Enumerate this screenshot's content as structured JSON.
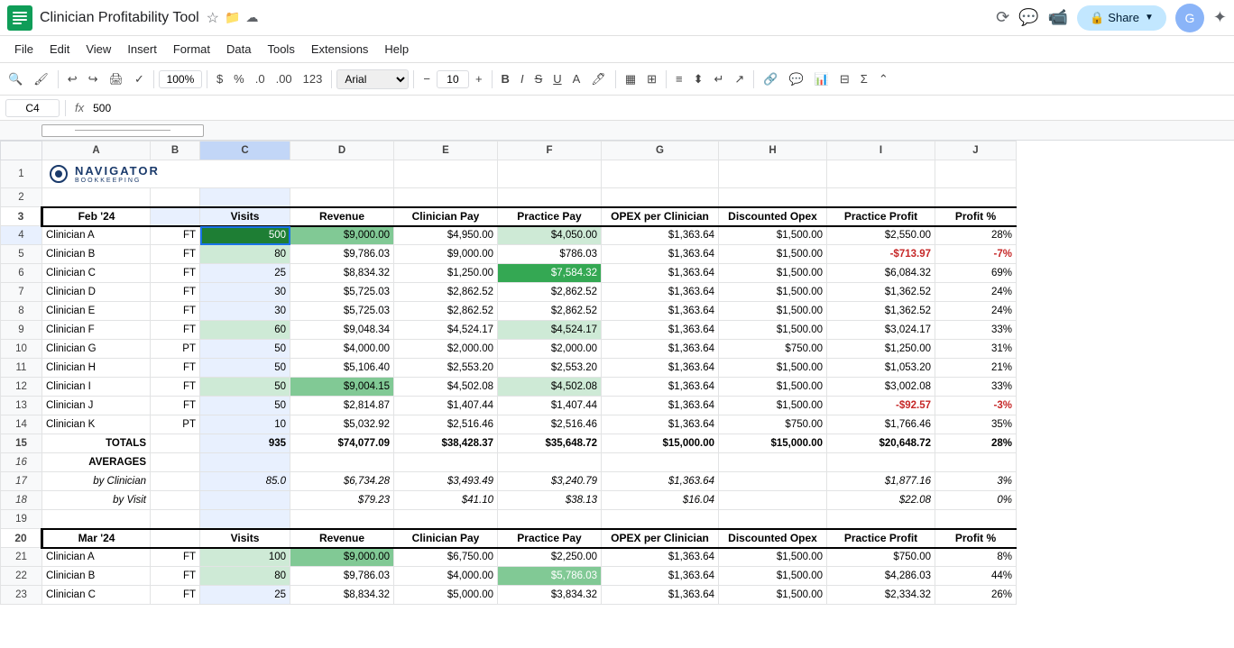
{
  "titleBar": {
    "appName": "Clinician Profitability Tool",
    "starIcon": "★",
    "driveIcon": "📁",
    "cloudIcon": "☁",
    "historyIcon": "⟲",
    "chatIcon": "💬",
    "videoIcon": "📹",
    "shareLabel": "Share",
    "accentColor": "#c2e7ff"
  },
  "menuBar": {
    "items": [
      "File",
      "Edit",
      "View",
      "Insert",
      "Format",
      "Data",
      "Tools",
      "Extensions",
      "Help"
    ]
  },
  "toolbar": {
    "zoomLevel": "100%",
    "currencySymbol": "$",
    "percentSymbol": "%",
    "decDecimals": ".0",
    "incDecimals": ".00",
    "format123": "123",
    "fontFamily": "Arial",
    "fontSize": "10",
    "boldB": "B",
    "italicI": "I",
    "strikeS": "S"
  },
  "formulaBar": {
    "cellRef": "C4",
    "fxLabel": "fx",
    "formula": "500"
  },
  "columnHeaders": [
    "A",
    "B",
    "C",
    "D",
    "E",
    "F",
    "G",
    "H",
    "I",
    "J"
  ],
  "feb24Header": {
    "period": "Feb '24",
    "visits": "Visits",
    "revenue": "Revenue",
    "clinicianPay": "Clinician Pay",
    "practicePay": "Practice Pay",
    "opexPerClinician": "OPEX per Clinician",
    "discountedOpex": "Discounted Opex",
    "practiceProfit": "Practice Profit",
    "profitPct": "Profit %"
  },
  "feb24Rows": [
    {
      "name": "Clinician A",
      "type": "FT",
      "visits": "500",
      "revenue": "$9,000.00",
      "clinPay": "$4,950.00",
      "pracPay": "$4,050.00",
      "opex": "$1,363.64",
      "discOpex": "$1,500.00",
      "profit": "$2,550.00",
      "profitPct": "28%",
      "visitsBg": "green-dark",
      "clinPayBg": "",
      "pracPayBg": "green-pale"
    },
    {
      "name": "Clinician B",
      "type": "FT",
      "visits": "80",
      "revenue": "$9,786.03",
      "clinPay": "$9,000.00",
      "pracPay": "$786.03",
      "opex": "$1,363.64",
      "discOpex": "$1,500.00",
      "profit": "-$713.97",
      "profitPct": "-7%",
      "visitsBg": "green-pale",
      "clinPayBg": "",
      "pracPayBg": "",
      "profitRed": true
    },
    {
      "name": "Clinician C",
      "type": "FT",
      "visits": "25",
      "revenue": "$8,834.32",
      "clinPay": "$1,250.00",
      "pracPay": "$7,584.32",
      "opex": "$1,363.64",
      "discOpex": "$1,500.00",
      "profit": "$6,084.32",
      "profitPct": "69%",
      "visitsBg": "",
      "clinPayBg": "",
      "pracPayBg": "green-med"
    },
    {
      "name": "Clinician D",
      "type": "FT",
      "visits": "30",
      "revenue": "$5,725.03",
      "clinPay": "$2,862.52",
      "pracPay": "$2,862.52",
      "opex": "$1,363.64",
      "discOpex": "$1,500.00",
      "profit": "$1,362.52",
      "profitPct": "24%",
      "visitsBg": "",
      "clinPayBg": "",
      "pracPayBg": ""
    },
    {
      "name": "Clinician E",
      "type": "FT",
      "visits": "30",
      "revenue": "$5,725.03",
      "clinPay": "$2,862.52",
      "pracPay": "$2,862.52",
      "opex": "$1,363.64",
      "discOpex": "$1,500.00",
      "profit": "$1,362.52",
      "profitPct": "24%",
      "visitsBg": "",
      "clinPayBg": "",
      "pracPayBg": ""
    },
    {
      "name": "Clinician F",
      "type": "FT",
      "visits": "60",
      "revenue": "$9,048.34",
      "clinPay": "$4,524.17",
      "pracPay": "$4,524.17",
      "opex": "$1,363.64",
      "discOpex": "$1,500.00",
      "profit": "$3,024.17",
      "profitPct": "33%",
      "visitsBg": "green-pale",
      "clinPayBg": "",
      "pracPayBg": "green-pale"
    },
    {
      "name": "Clinician G",
      "type": "PT",
      "visits": "50",
      "revenue": "$4,000.00",
      "clinPay": "$2,000.00",
      "pracPay": "$2,000.00",
      "opex": "$1,363.64",
      "discOpex": "$750.00",
      "profit": "$1,250.00",
      "profitPct": "31%",
      "visitsBg": "",
      "clinPayBg": "",
      "pracPayBg": ""
    },
    {
      "name": "Clinician H",
      "type": "FT",
      "visits": "50",
      "revenue": "$5,106.40",
      "clinPay": "$2,553.20",
      "pracPay": "$2,553.20",
      "opex": "$1,363.64",
      "discOpex": "$1,500.00",
      "profit": "$1,053.20",
      "profitPct": "21%",
      "visitsBg": "",
      "clinPayBg": "",
      "pracPayBg": ""
    },
    {
      "name": "Clinician I",
      "type": "FT",
      "visits": "50",
      "revenue": "$9,004.15",
      "clinPay": "$4,502.08",
      "pracPay": "$4,502.08",
      "opex": "$1,363.64",
      "discOpex": "$1,500.00",
      "profit": "$3,002.08",
      "profitPct": "33%",
      "visitsBg": "green-pale",
      "clinPayBg": "",
      "pracPayBg": "green-pale"
    },
    {
      "name": "Clinician J",
      "type": "FT",
      "visits": "50",
      "revenue": "$2,814.87",
      "clinPay": "$1,407.44",
      "pracPay": "$1,407.44",
      "opex": "$1,363.64",
      "discOpex": "$1,500.00",
      "profit": "-$92.57",
      "profitPct": "-3%",
      "visitsBg": "",
      "clinPayBg": "",
      "pracPayBg": "",
      "profitRed": true
    },
    {
      "name": "Clinician K",
      "type": "PT",
      "visits": "10",
      "revenue": "$5,032.92",
      "clinPay": "$2,516.46",
      "pracPay": "$2,516.46",
      "opex": "$1,363.64",
      "discOpex": "$750.00",
      "profit": "$1,766.46",
      "profitPct": "35%",
      "visitsBg": "",
      "clinPayBg": "",
      "pracPayBg": ""
    }
  ],
  "feb24Totals": {
    "label": "TOTALS",
    "visits": "935",
    "revenue": "$74,077.09",
    "clinPay": "$38,428.37",
    "pracPay": "$35,648.72",
    "opex": "$15,000.00",
    "discOpex": "$15,000.00",
    "profit": "$20,648.72",
    "profitPct": "28%"
  },
  "feb24Averages": {
    "label": "AVERAGES",
    "byClinician": "by Clinician",
    "byVisit": "by Visit",
    "clinVisits": "85.0",
    "clinRevenue": "$6,734.28",
    "clinPay": "$3,493.49",
    "clinPracPay": "$3,240.79",
    "clinOpex": "$1,363.64",
    "clinProfit": "$1,877.16",
    "clinPct": "3%",
    "visitRevenue": "$79.23",
    "visitPay": "$41.10",
    "visitPracPay": "$38.13",
    "visitOpex": "$16.04",
    "visitProfit": "$22.08",
    "visitPct": "0%"
  },
  "mar24Header": {
    "period": "Mar '24",
    "visits": "Visits",
    "revenue": "Revenue",
    "clinicianPay": "Clinician Pay",
    "practicePay": "Practice Pay",
    "opexPerClinician": "OPEX per Clinician",
    "discountedOpex": "Discounted Opex",
    "practiceProfit": "Practice Profit",
    "profitPct": "Profit %"
  },
  "mar24Rows": [
    {
      "name": "Clinician A",
      "type": "FT",
      "visits": "100",
      "revenue": "$9,000.00",
      "clinPay": "$6,750.00",
      "pracPay": "$2,250.00",
      "opex": "$1,363.64",
      "discOpex": "$1,500.00",
      "profit": "$750.00",
      "profitPct": "8%",
      "visitsBg": "green-pale"
    },
    {
      "name": "Clinician B",
      "type": "FT",
      "visits": "80",
      "revenue": "$9,786.03",
      "clinPay": "$4,000.00",
      "pracPay": "$5,786.03",
      "opex": "$1,363.64",
      "discOpex": "$1,500.00",
      "profit": "$4,286.03",
      "profitPct": "44%",
      "pracPayBg": "green-light"
    },
    {
      "name": "Clinician C",
      "type": "FT",
      "visits": "25",
      "revenue": "$8,834.32",
      "clinPay": "$5,000.00",
      "pracPay": "$3,834.32",
      "opex": "$1,363.64",
      "discOpex": "$1,500.00",
      "profit": "$2,334.32",
      "profitPct": "26%"
    }
  ],
  "logos": {
    "navigatorText": "NAVIGATOR",
    "bookkeepingText": "BOOKKEEPING"
  }
}
